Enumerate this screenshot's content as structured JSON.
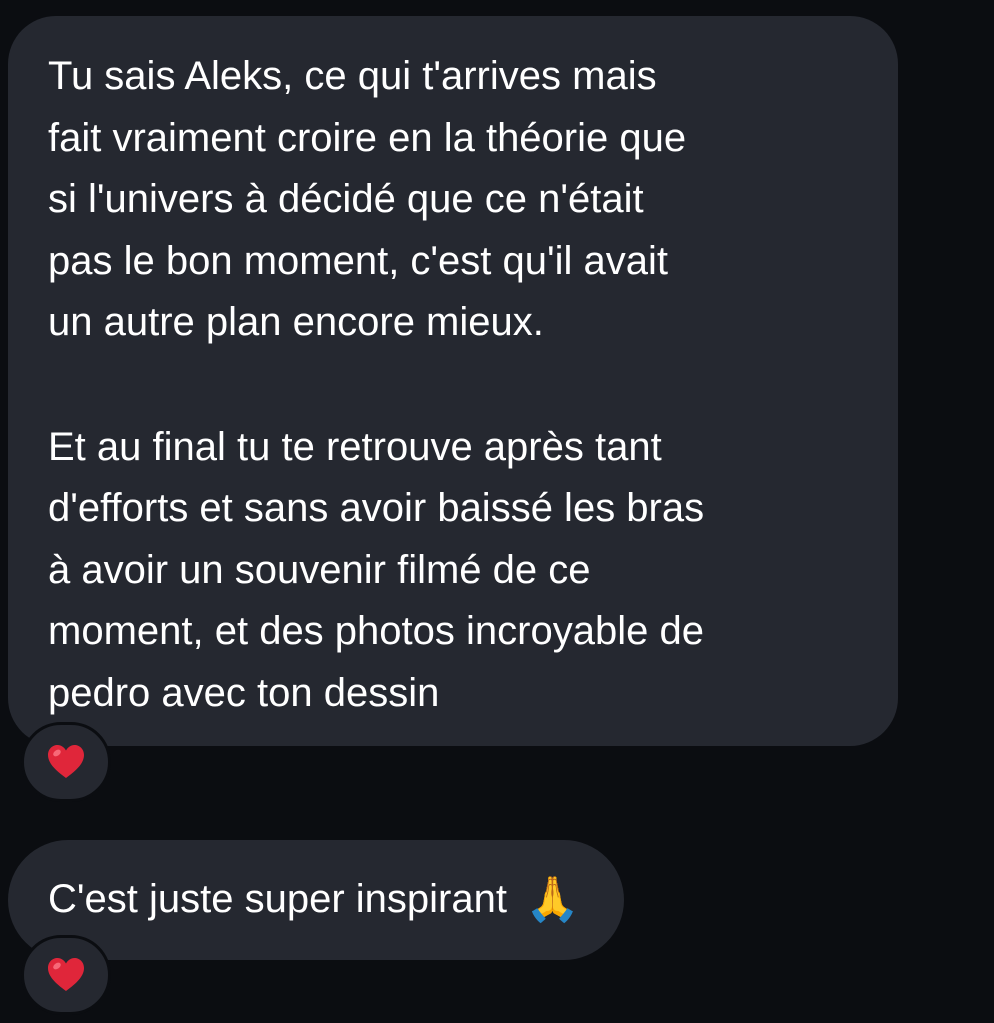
{
  "messages": [
    {
      "lines": [
        "Tu sais Aleks, ce qui t'arrives mais",
        "fait vraiment croire en la théorie que",
        "si l'univers à décidé que ce n'était",
        "pas le bon moment, c'est qu'il avait",
        "un autre plan encore mieux.",
        "",
        "Et au final tu te retrouve après tant",
        "d'efforts et sans avoir baissé les bras",
        "à avoir un souvenir filmé de ce",
        "moment, et des photos incroyable de",
        "pedro avec ton dessin"
      ],
      "reaction": "❤️",
      "reaction_icon": "red-heart-icon"
    },
    {
      "text": "C'est juste super inspirant",
      "emoji": "🙏",
      "emoji_icon": "folded-hands-icon",
      "reaction": "❤️",
      "reaction_icon": "red-heart-icon"
    }
  ],
  "colors": {
    "background": "#0b0d11",
    "bubble": "#252830",
    "text": "#ffffff",
    "heart": "#e0263a"
  }
}
